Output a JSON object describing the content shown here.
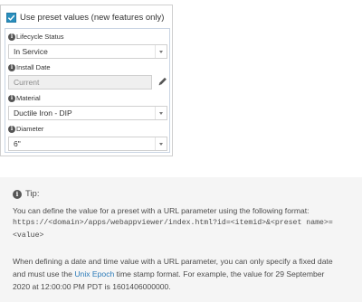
{
  "preset": {
    "checkbox_label": "Use preset values (new features only)",
    "checked": true,
    "fields": [
      {
        "label": "Lifecycle Status",
        "value": "In Service",
        "kind": "select"
      },
      {
        "label": "Install Date",
        "value": "Current",
        "kind": "date"
      },
      {
        "label": "Material",
        "value": "Ductile Iron - DIP",
        "kind": "select"
      },
      {
        "label": "Diameter",
        "value": "6\"",
        "kind": "select"
      }
    ]
  },
  "tip": {
    "title": "Tip:",
    "line1": "You can define the value for a preset with a URL parameter using the following format:",
    "code1": "https://<domain>/apps/webappviewer/index.html?id=<itemid>&<preset name>=",
    "code2": "<value>",
    "para2_a": "When defining a date and time value with a URL parameter, you can only specify a fixed date",
    "para2_b_before": "and must use the ",
    "para2_b_link": "Unix Epoch",
    "para2_b_after": " time stamp format. For example, the value for 29 September",
    "para2_c": "2020 at 12:00:00 PM PDT is 1601406000000."
  },
  "colors": {
    "accent": "#2a8fbd",
    "link": "#2a7ab8",
    "tip_background": "#f5f5f5"
  },
  "icons": [
    "checkmark-icon",
    "info-icon",
    "chevron-down-icon",
    "pencil-icon"
  ]
}
